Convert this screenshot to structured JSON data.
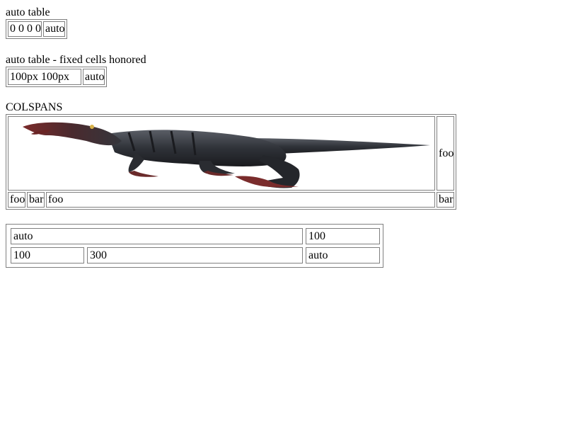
{
  "sections": {
    "auto_table": {
      "title": "auto table",
      "cells": [
        "0 0 0 0",
        "auto"
      ]
    },
    "fixed_table": {
      "title": "auto table - fixed cells honored",
      "cells": [
        "100px 100px",
        "auto"
      ]
    },
    "colspans": {
      "title": "COLSPANS",
      "image_icon": "dinosaur-image",
      "side_cell": "foo",
      "bottom_cells": [
        "foo",
        "bar",
        "foo"
      ],
      "bottom_right_cell": "bar"
    },
    "grid_table": {
      "row1": [
        "auto",
        "100"
      ],
      "row2": [
        "100",
        "300",
        "auto"
      ]
    }
  }
}
